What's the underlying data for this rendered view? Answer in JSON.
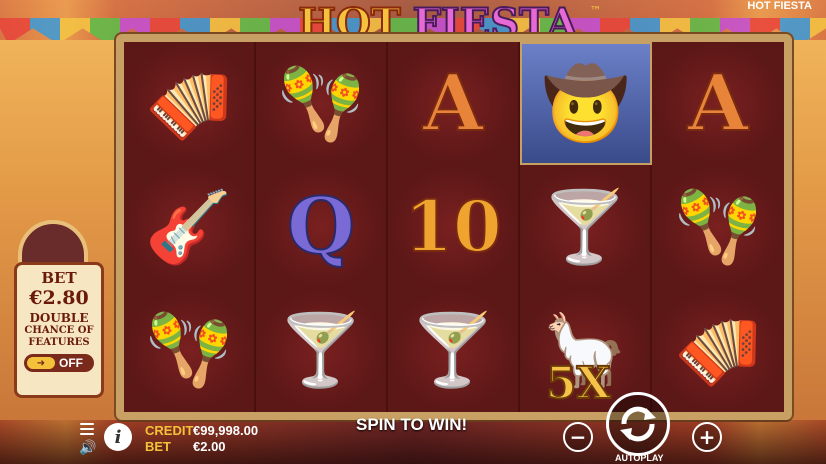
{
  "game": {
    "logo_hot": "HOT",
    "logo_fiesta": "FIESTA",
    "logo_tm": "™",
    "corner_title": "HOT FIESTA"
  },
  "reels": {
    "row1": [
      "accordion-icon",
      "maracas-icon",
      "A",
      "mariachi-icon",
      "A"
    ],
    "row2": [
      "guitar-icon",
      "Q",
      "10",
      "margarita-icon",
      "maracas-icon"
    ],
    "row3": [
      "maracas-icon",
      "margarita-icon",
      "margarita-icon",
      "pinata-icon",
      "accordion-icon"
    ],
    "multiplier": "5X"
  },
  "bet_panel": {
    "title": "BET",
    "amount": "€2.80",
    "double": "DOUBLE",
    "chance_line1": "CHANCE OF",
    "chance_line2": "FEATURES",
    "toggle_state": "OFF"
  },
  "footer": {
    "credit_label": "CREDIT",
    "credit_value": "€99,998.00",
    "bet_label": "BET",
    "bet_value": "€2.00",
    "spin_message": "SPIN TO WIN!",
    "autoplay_label": "AUTOPLAY",
    "minus_label": "−",
    "plus_label": "+"
  },
  "colors": {
    "frame": "#c9a063",
    "reel_bg": "#5c1717",
    "accent_gold": "#f3c23a"
  }
}
